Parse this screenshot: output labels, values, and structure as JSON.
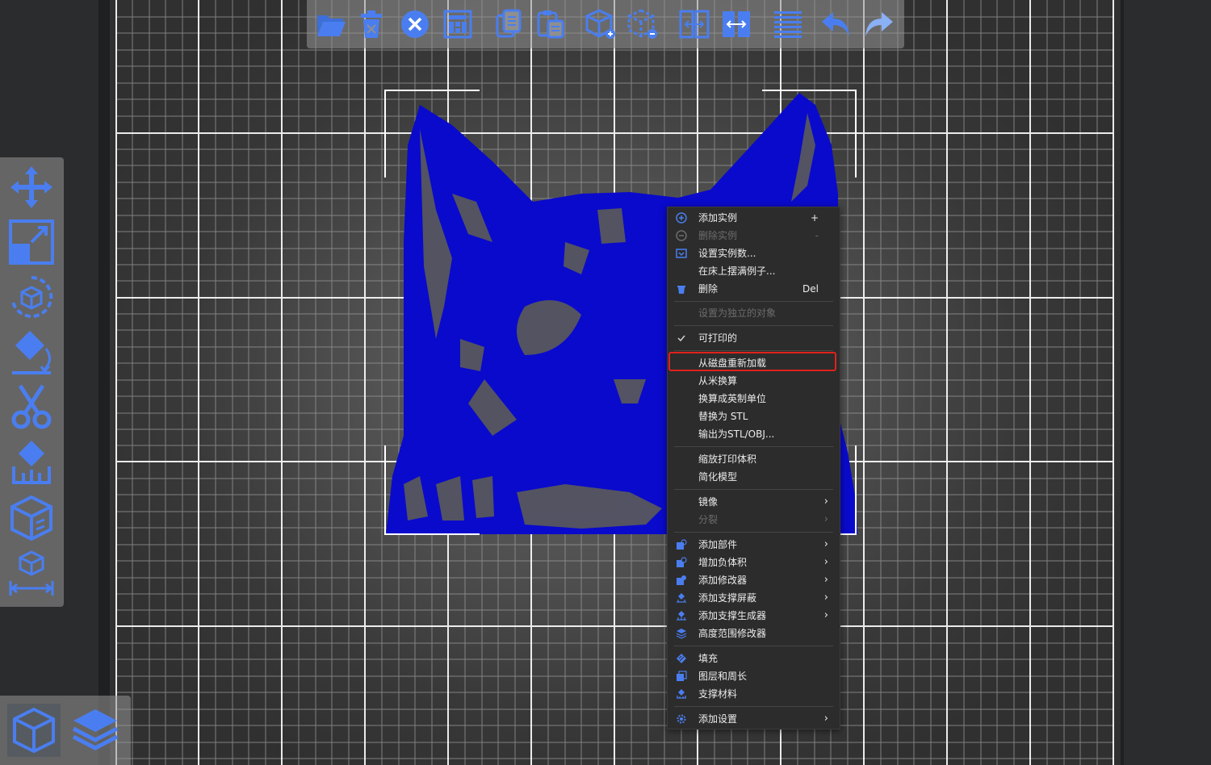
{
  "toolbar": {
    "icons": [
      "open-folder-icon",
      "delete-icon",
      "delete-all-icon",
      "arrange-icon",
      "copy-icon",
      "paste-icon",
      "add-instance-icon",
      "remove-instance-icon",
      "split-to-objects-icon",
      "split-to-parts-icon",
      "layers-editing-icon",
      "undo-icon",
      "redo-icon"
    ]
  },
  "left_toolbar": {
    "icons": [
      "move-icon",
      "scale-icon",
      "rotate-icon",
      "place-on-face-icon",
      "cut-icon",
      "support-paint-icon",
      "seam-paint-icon",
      "measure-icon"
    ]
  },
  "view_toolbar": {
    "icons": [
      "3d-view-icon",
      "preview-layers-icon"
    ],
    "active": "3d-view-icon"
  },
  "context_menu": {
    "items": [
      {
        "label": "添加实例",
        "shortcut": "+",
        "icon": "plus-circle-icon",
        "disabled": false
      },
      {
        "label": "删除实例",
        "shortcut": "-",
        "icon": "minus-circle-icon",
        "disabled": true
      },
      {
        "label": "设置实例数...",
        "icon": "set-instances-icon",
        "disabled": false
      },
      {
        "label": "在床上摆满例子...",
        "disabled": false
      },
      {
        "label": "删除",
        "shortcut": "Del",
        "icon": "trash-icon",
        "disabled": false
      },
      {
        "label": "设置为独立的对象",
        "disabled": true
      },
      {
        "label": "可打印的",
        "icon": "checkmark-icon",
        "checked": true,
        "disabled": false
      },
      {
        "label": "从磁盘重新加载",
        "highlighted": true,
        "disabled": false
      },
      {
        "label": "从米换算",
        "disabled": false
      },
      {
        "label": "换算成英制单位",
        "disabled": false
      },
      {
        "label": "替换为 STL",
        "disabled": false
      },
      {
        "label": "输出为STL/OBJ...",
        "disabled": false
      },
      {
        "label": "缩放打印体积",
        "disabled": false
      },
      {
        "label": "简化模型",
        "disabled": false
      },
      {
        "label": "镜像",
        "submenu": true,
        "disabled": false
      },
      {
        "label": "分裂",
        "submenu": true,
        "disabled": true
      },
      {
        "label": "添加部件",
        "submenu": true,
        "icon": "add-part-icon",
        "disabled": false
      },
      {
        "label": "增加负体积",
        "submenu": true,
        "icon": "add-negative-volume-icon",
        "disabled": false
      },
      {
        "label": "添加修改器",
        "submenu": true,
        "icon": "add-modifier-icon",
        "disabled": false
      },
      {
        "label": "添加支撑屏蔽",
        "submenu": true,
        "icon": "support-blocker-icon",
        "disabled": false
      },
      {
        "label": "添加支撑生成器",
        "submenu": true,
        "icon": "support-enforcer-icon",
        "disabled": false
      },
      {
        "label": "高度范围修改器",
        "icon": "height-range-icon",
        "disabled": false
      },
      {
        "label": "填充",
        "icon": "infill-icon",
        "disabled": false
      },
      {
        "label": "图层和周长",
        "icon": "layers-perimeters-icon",
        "disabled": false
      },
      {
        "label": "支撑材料",
        "icon": "support-material-icon",
        "disabled": false
      },
      {
        "label": "添加设置",
        "submenu": true,
        "icon": "gear-icon",
        "disabled": false
      }
    ]
  },
  "colors": {
    "accent": "#4a7ef0",
    "model": "#0a0acc",
    "highlight_border": "#e0221b",
    "menu_bg": "#2c2c2c"
  }
}
